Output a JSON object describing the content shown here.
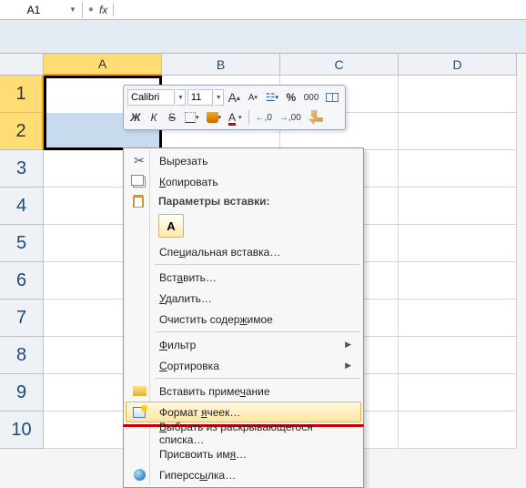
{
  "formula_bar": {
    "cell_ref": "A1",
    "fx_label": "fx",
    "formula_value": ""
  },
  "columns": [
    "A",
    "B",
    "C",
    "D"
  ],
  "rows": [
    "1",
    "2",
    "3",
    "4",
    "5",
    "6",
    "7",
    "8",
    "9",
    "10"
  ],
  "selected_col_index": 0,
  "selected_row_indices": [
    0,
    1
  ],
  "mini_toolbar": {
    "font_name": "Calibri",
    "font_size": "11",
    "grow_A": "A",
    "shrink_A": "A",
    "percent": "%",
    "thousands": "000",
    "bold": "Ж",
    "italic": "К",
    "strike": "S",
    "font_color_A": "A",
    "dec_inc": ",0",
    "dec_inc_sup": ",00",
    "dec_dec": ",00",
    "dec_dec_sup": ",0"
  },
  "context_menu": {
    "cut": "Вырезать",
    "copy": "Копировать",
    "paste_header": "Параметры вставки:",
    "paste_option_glyph": "A",
    "paste_special": "Специальная вставка…",
    "insert": "Вставить…",
    "delete": "Удалить…",
    "clear": "Очистить содержимое",
    "filter": "Фильтр",
    "sort": "Сортировка",
    "comment": "Вставить примечание",
    "format_cells": "Формат ячеек…",
    "dropdown_pick": "Выбрать из раскрывающегося списка…",
    "define_name": "Присвоить имя…",
    "hyperlink": "Гиперссылка…",
    "arrow": "▶"
  }
}
